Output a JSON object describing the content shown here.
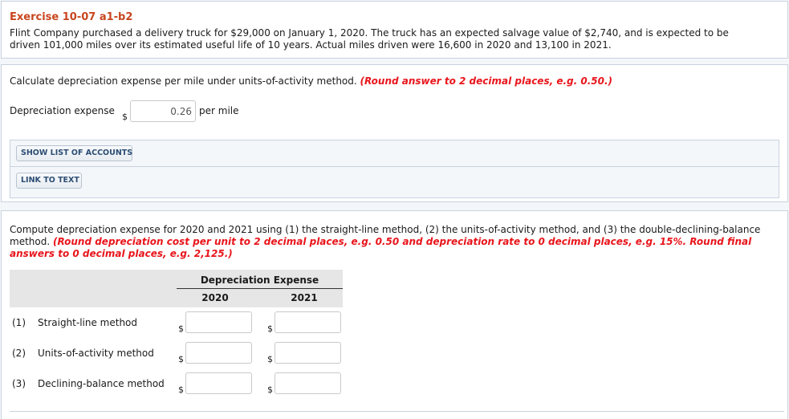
{
  "intro": {
    "title": "Exercise 10-07 a1-b2",
    "text_line1": "Flint Company purchased a delivery truck for $29,000 on January 1, 2020. The truck has an expected salvage value of $2,740, and is expected to be",
    "text_line2": "driven 101,000 miles over its estimated useful life of 10 years. Actual miles driven were 16,600 in 2020 and 13,100 in 2021."
  },
  "part1": {
    "question": "Calculate depreciation expense per mile under units-of-activity method.",
    "instruction": "(Round answer to 2 decimal places, e.g. 0.50.)",
    "field_label": "Depreciation expense",
    "currency": "$",
    "value": "0.26",
    "unit": "per mile",
    "buttons": {
      "show_accounts": "SHOW LIST OF ACCOUNTS",
      "link_to_text": "LINK TO TEXT"
    }
  },
  "part2": {
    "question_line1": "Compute depreciation expense for 2020 and 2021 using (1) the straight-line method, (2) the units-of-activity method, and (3) the double-declining-balance",
    "question_line2_start": "method.",
    "instruction_line2": "(Round depreciation cost per unit to 2 decimal places, e.g. 0.50 and depreciation rate to 0 decimal places, e.g. 15%. Round final",
    "instruction_line3": "answers to 0 decimal places, e.g. 2,125.)",
    "table": {
      "group_header": "Depreciation Expense",
      "columns": [
        "2020",
        "2021"
      ],
      "currency": "$",
      "rows": [
        {
          "num": "(1)",
          "label": "Straight-line method",
          "values": [
            "",
            ""
          ]
        },
        {
          "num": "(2)",
          "label": "Units-of-activity method",
          "values": [
            "",
            ""
          ]
        },
        {
          "num": "(3)",
          "label": "Declining-balance method",
          "values": [
            "",
            ""
          ]
        }
      ]
    }
  }
}
